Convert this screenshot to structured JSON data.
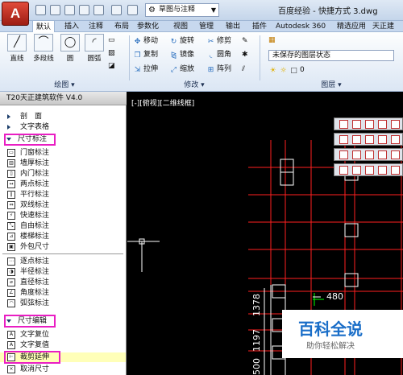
{
  "titlebar": {
    "app_button": "A",
    "workspace": "草图与注释",
    "doc_title": "百度经验 - 快捷方式 3.dwg"
  },
  "ribbon_tabs": [
    "默认",
    "插入",
    "注释",
    "布局",
    "参数化",
    "视图",
    "管理",
    "输出",
    "插件",
    "Autodesk 360",
    "精选应用",
    "天正建"
  ],
  "ribbon": {
    "draw_tools": [
      {
        "label": "直线",
        "icon": "line-icon"
      },
      {
        "label": "多段线",
        "icon": "polyline-icon"
      },
      {
        "label": "圆",
        "icon": "circle-icon"
      },
      {
        "label": "圆弧",
        "icon": "arc-icon"
      }
    ],
    "modify_tools": [
      {
        "label": "移动",
        "icon": "move-icon"
      },
      {
        "label": "旋转",
        "icon": "rotate-icon"
      },
      {
        "label": "修剪",
        "icon": "trim-icon"
      },
      {
        "label": "复制",
        "icon": "copy-icon"
      },
      {
        "label": "镜像",
        "icon": "mirror-icon"
      },
      {
        "label": "圆角",
        "icon": "fillet-icon"
      },
      {
        "label": "拉伸",
        "icon": "stretch-icon"
      },
      {
        "label": "缩放",
        "icon": "scale-icon"
      },
      {
        "label": "阵列",
        "icon": "array-icon"
      }
    ],
    "layer_state": "未保存的图层状态",
    "layer_current": "0",
    "groups": {
      "draw": "绘图",
      "modify": "修改",
      "layer": "图层"
    }
  },
  "panel": {
    "title": "T20天正建筑软件 V4.0",
    "top_items": [
      "剖　面",
      "文字表格"
    ],
    "section1": "尺寸标注",
    "dim_items": [
      "门窗标注",
      "墙厚标注",
      "内门标注",
      "两点标注",
      "平行标注",
      "双线标注",
      "快速标注",
      "自由标注",
      "楼梯标注",
      "外包尺寸",
      "逐点标注",
      "半径标注",
      "直径标注",
      "角度标注",
      "弧弦标注"
    ],
    "section2": "尺寸编辑",
    "edit_items": [
      "文字复位",
      "文字复值",
      "裁剪延伸",
      "取消尺寸"
    ]
  },
  "viewport": {
    "label": "[-][俯视][二维线框]",
    "dim_horizontal": "480",
    "dim_vertical_1": "1378",
    "dim_vertical_2": "1197",
    "dim_vertical_3": "500"
  },
  "watermark": {
    "title": "百科全说",
    "subtitle": "助你轻松解决"
  },
  "colors": {
    "highlight": "#e91ec3",
    "grid_red": "#ff2020",
    "accent": "#1a6ec8"
  }
}
